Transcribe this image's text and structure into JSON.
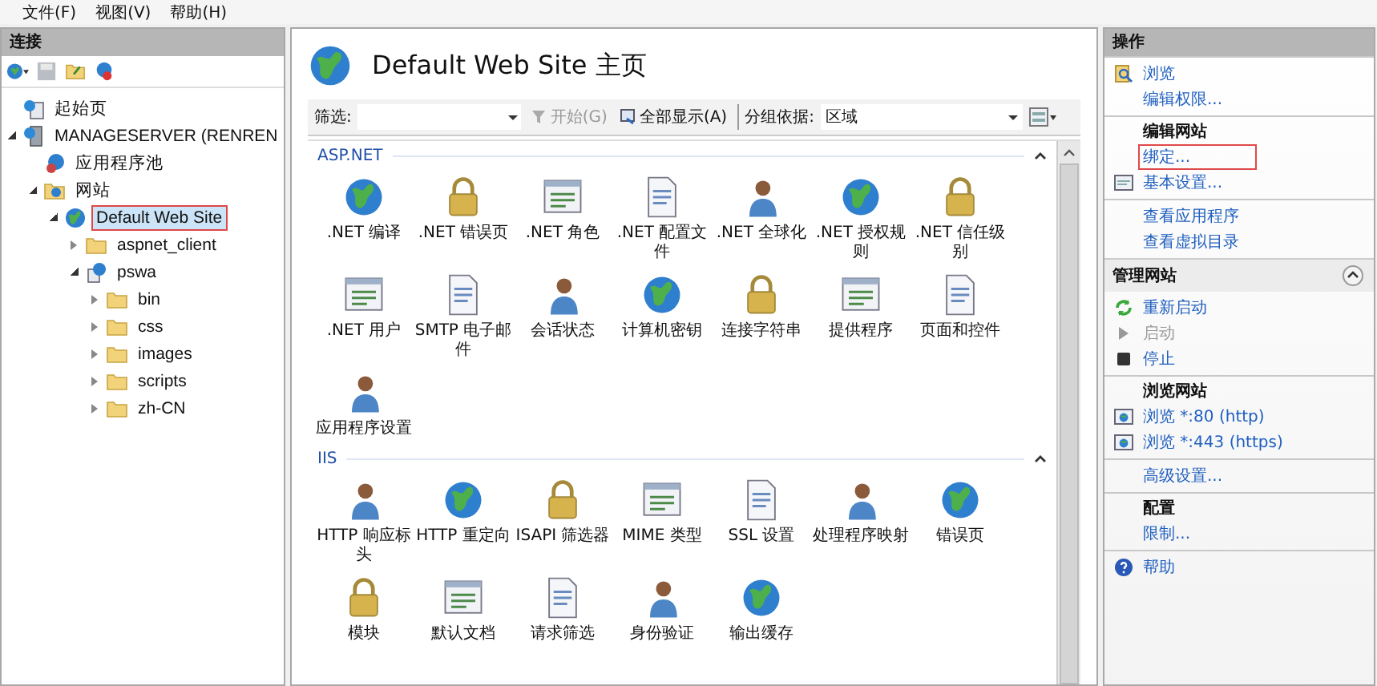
{
  "menu": [
    "文件(F)",
    "视图(V)",
    "帮助(H)"
  ],
  "connections": {
    "title": "连接",
    "tree": [
      {
        "label": "起始页",
        "kind": "page",
        "selected": false,
        "highlighted": false
      },
      {
        "label": "MANAGESERVER (RENREN",
        "kind": "server",
        "expanded": true,
        "selected": false,
        "highlighted": false,
        "children": [
          {
            "label": "应用程序池",
            "kind": "pool",
            "selected": false,
            "highlighted": false
          },
          {
            "label": "网站",
            "kind": "sites",
            "expanded": true,
            "selected": false,
            "highlighted": false,
            "children": [
              {
                "label": "Default Web Site",
                "kind": "site",
                "expanded": true,
                "selected": true,
                "highlighted": true,
                "children": [
                  {
                    "label": "aspnet_client",
                    "kind": "folder",
                    "expanded": false,
                    "selected": false,
                    "highlighted": false
                  },
                  {
                    "label": "pswa",
                    "kind": "app",
                    "expanded": true,
                    "selected": false,
                    "highlighted": false,
                    "children": [
                      {
                        "label": "bin",
                        "kind": "folder",
                        "expanded": false,
                        "selected": false,
                        "highlighted": false
                      },
                      {
                        "label": "css",
                        "kind": "folder",
                        "expanded": false,
                        "selected": false,
                        "highlighted": false
                      },
                      {
                        "label": "images",
                        "kind": "folder",
                        "expanded": false,
                        "selected": false,
                        "highlighted": false
                      },
                      {
                        "label": "scripts",
                        "kind": "folder",
                        "expanded": false,
                        "selected": false,
                        "highlighted": false
                      },
                      {
                        "label": "zh-CN",
                        "kind": "folder",
                        "expanded": false,
                        "selected": false,
                        "highlighted": false
                      }
                    ]
                  }
                ]
              }
            ]
          }
        ]
      }
    ]
  },
  "home": {
    "title": "Default Web Site 主页",
    "toolbar": {
      "filter_label": "筛选:",
      "go": "开始(G)",
      "show_all": "全部显示(A)",
      "group_label": "分组依据:",
      "group_value": "区域"
    },
    "groups": [
      {
        "title": "ASP.NET",
        "expanded": true,
        "items": [
          ".NET 编译",
          ".NET 错误页",
          ".NET 角色",
          ".NET 配置文件",
          ".NET 全球化",
          ".NET 授权规则",
          ".NET 信任级别",
          ".NET 用户",
          "SMTP 电子邮件",
          "会话状态",
          "计算机密钥",
          "连接字符串",
          "提供程序",
          "页面和控件",
          "应用程序设置"
        ]
      },
      {
        "title": "IIS",
        "expanded": true,
        "items": [
          "HTTP 响应标头",
          "HTTP 重定向",
          "ISAPI 筛选器",
          "MIME 类型",
          "SSL 设置",
          "处理程序映射",
          "错误页",
          "模块",
          "默认文档",
          "请求筛选",
          "身份验证",
          "输出缓存"
        ]
      }
    ]
  },
  "actions": {
    "title": "操作",
    "sections": [
      {
        "items": [
          {
            "label": "浏览",
            "kind": "browse",
            "disabled": false,
            "highlighted": false
          },
          {
            "label": "编辑权限...",
            "kind": "link",
            "disabled": false,
            "highlighted": false
          }
        ]
      },
      {
        "title": "编辑网站",
        "items": [
          {
            "label": "绑定...",
            "kind": "link",
            "disabled": false,
            "highlighted": true
          },
          {
            "label": "基本设置...",
            "kind": "settings",
            "disabled": false,
            "highlighted": false
          }
        ]
      },
      {
        "items": [
          {
            "label": "查看应用程序",
            "kind": "link",
            "disabled": false,
            "highlighted": false
          },
          {
            "label": "查看虚拟目录",
            "kind": "link",
            "disabled": false,
            "highlighted": false
          }
        ]
      }
    ],
    "manage": {
      "title": "管理网站",
      "expanded": true,
      "sections": [
        {
          "items": [
            {
              "label": "重新启动",
              "kind": "restart",
              "disabled": false,
              "highlighted": false
            },
            {
              "label": "启动",
              "kind": "start",
              "disabled": true,
              "highlighted": false
            },
            {
              "label": "停止",
              "kind": "stop",
              "disabled": false,
              "highlighted": false
            }
          ]
        },
        {
          "title": "浏览网站",
          "items": [
            {
              "label": "浏览 *:80 (http)",
              "kind": "web",
              "disabled": false,
              "highlighted": false
            },
            {
              "label": "浏览 *:443 (https)",
              "kind": "web",
              "disabled": false,
              "highlighted": false
            }
          ]
        },
        {
          "items": [
            {
              "label": "高级设置...",
              "kind": "link",
              "disabled": false,
              "highlighted": false
            }
          ]
        },
        {
          "title": "配置",
          "items": [
            {
              "label": "限制...",
              "kind": "link",
              "disabled": false,
              "highlighted": false
            }
          ]
        },
        {
          "items": [
            {
              "label": "帮助",
              "kind": "help",
              "disabled": false,
              "highlighted": false
            }
          ]
        }
      ]
    }
  }
}
